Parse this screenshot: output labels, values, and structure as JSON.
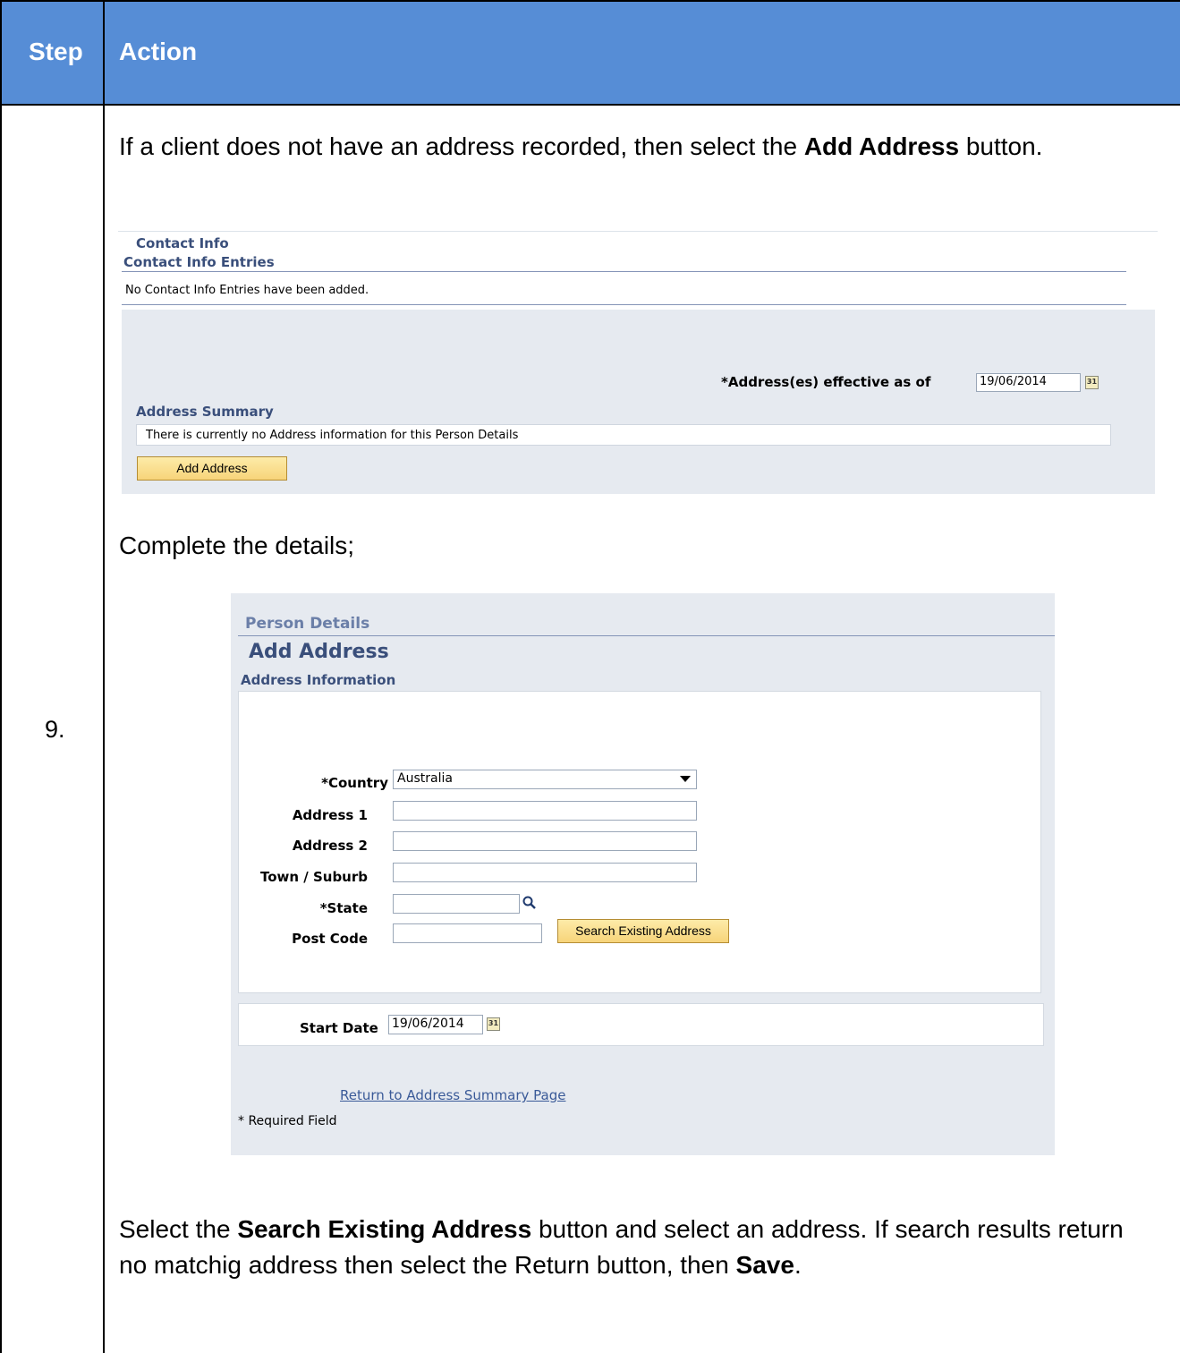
{
  "header": {
    "step": "Step",
    "action": "Action"
  },
  "step_number": "9.",
  "intro": {
    "before": "If a client does not have an address recorded, then select the ",
    "bold": "Add Address",
    "after": " button."
  },
  "contact_panel": {
    "title": "Contact Info",
    "entries_title": "Contact Info Entries",
    "empty_message": "No Contact Info Entries have been added.",
    "effective_label": "*Address(es) effective as of",
    "effective_date": "19/06/2014",
    "calendar_glyph": "31",
    "summary_title": "Address Summary",
    "summary_message": "There is currently no Address information for this Person Details",
    "add_button": "Add Address"
  },
  "complete_text": "Complete the details;",
  "address_form": {
    "breadcrumb": "Person Details",
    "title": "Add Address",
    "section": "Address Information",
    "country_label": "*Country",
    "country_value": "Australia",
    "address1_label": "Address 1",
    "address2_label": "Address 2",
    "town_label": "Town / Suburb",
    "state_label": "*State",
    "postcode_label": "Post Code",
    "search_button": "Search Existing Address",
    "start_date_label": "Start Date",
    "start_date": "19/06/2014",
    "calendar_glyph": "31",
    "return_link": "Return to Address Summary Page",
    "required_note": "* Required Field"
  },
  "closing": {
    "p1": "Select the ",
    "b1": "Search Existing Address",
    "p2": " button and select an address. If search results return no matchig address then select the Return button, then ",
    "b2": "Save",
    "p3": "."
  },
  "colors": {
    "header_blue": "#568dd6",
    "panel_grey": "#e6eaf0",
    "button_yellow": "#f7d47a",
    "ps_heading": "#3a4f7b"
  }
}
